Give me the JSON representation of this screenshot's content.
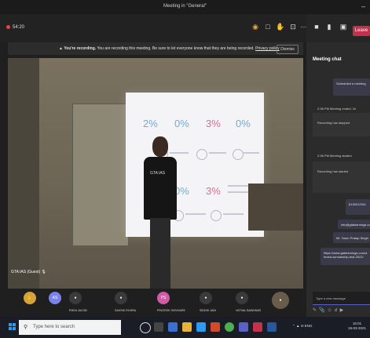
{
  "window": {
    "title": "Meeting in \"General\"",
    "minimize": "–"
  },
  "toolbar": {
    "timer": "54:20",
    "leave_label": "Leave"
  },
  "banner": {
    "bold": "You're recording.",
    "text": "You are recording this meeting. Be sure to let everyone know that they are being recorded.",
    "link": "Privacy policy",
    "dismiss": "Dismiss"
  },
  "video": {
    "speaker_label": "GTA IAS (Guest)",
    "slide_stats": [
      "2%",
      "0%",
      "3%",
      "0%",
      "0%",
      "3%"
    ],
    "shirt_text": "GTA IAS"
  },
  "participants": [
    {
      "initials": "",
      "name": "",
      "color": "#d6a33a"
    },
    {
      "initials": "AS",
      "name": "",
      "color": "#7b83eb"
    },
    {
      "initials": "",
      "name": "RHEA JACOB",
      "color": "#3a3a3a"
    },
    {
      "initials": "",
      "name": "SAKSHI ROHRA",
      "color": "#3a3a3a"
    },
    {
      "initials": "PS",
      "name": "PRATEEK SHIVHARE",
      "color": "#d05ca6"
    },
    {
      "initials": "",
      "name": "SIDDHI JAIN",
      "color": "#3a3a3a"
    },
    {
      "initials": "",
      "name": "VATSAL BANKWAR",
      "color": "#3a3a3a"
    }
  ],
  "chat": {
    "title": "Meeting chat",
    "scheduled": "Scheduled a meeting",
    "msg1_time": "2:38 PM",
    "msg1_label": "Meeting ended: 1h",
    "msg1_body": "Recording has stopped",
    "msg2_time": "2:38 PM",
    "msg2_label": "Meeting started",
    "msg2_body": "Recording has started",
    "msg3_time": "3:09 PM",
    "msg3_phone": "8130012911",
    "msg4": "info@gtalearnings.com",
    "msg5": "Mr. Tarun Pratap Singh",
    "msg6": "https://www.gtalearnings.com/ahmed-scholarship-test-2021/",
    "new_message_placeholder": "Type a new message"
  },
  "taskbar": {
    "search_placeholder": "Type here to search",
    "time": "15:01",
    "date": "19-03-2021",
    "lang": "ENG"
  }
}
